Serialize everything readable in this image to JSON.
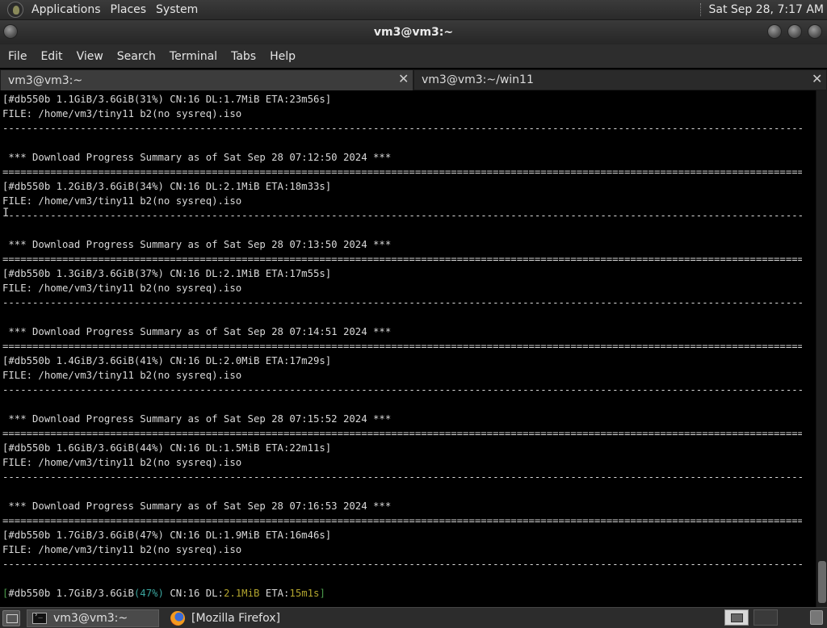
{
  "top_panel": {
    "menus": [
      "Applications",
      "Places",
      "System"
    ],
    "clock": "Sat Sep 28,  7:17 AM"
  },
  "window": {
    "title": "vm3@vm3:~"
  },
  "menubar": [
    "File",
    "Edit",
    "View",
    "Search",
    "Terminal",
    "Tabs",
    "Help"
  ],
  "tabs": [
    {
      "label": "vm3@vm3:~",
      "active": true
    },
    {
      "label": "vm3@vm3:~/win11",
      "active": false
    }
  ],
  "terminal": {
    "separator_dash": "-----------------------------------------------------------------------------------------------------------------------------------------------------",
    "separator_eq": "=====================================================================================================================================================",
    "first_status": "[#db550b 1.1GiB/3.6GiB(31%) CN:16 DL:1.7MiB ETA:23m56s]",
    "file_line": "FILE: /home/vm3/tiny11 b2(no sysreq).iso",
    "blocks": [
      {
        "summary": " *** Download Progress Summary as of Sat Sep 28 07:12:50 2024 ***",
        "status": "[#db550b 1.2GiB/3.6GiB(34%) CN:16 DL:2.1MiB ETA:18m33s]"
      },
      {
        "summary": " *** Download Progress Summary as of Sat Sep 28 07:13:50 2024 ***",
        "status": "[#db550b 1.3GiB/3.6GiB(37%) CN:16 DL:2.1MiB ETA:17m55s]"
      },
      {
        "summary": " *** Download Progress Summary as of Sat Sep 28 07:14:51 2024 ***",
        "status": "[#db550b 1.4GiB/3.6GiB(41%) CN:16 DL:2.0MiB ETA:17m29s]"
      },
      {
        "summary": " *** Download Progress Summary as of Sat Sep 28 07:15:52 2024 ***",
        "status": "[#db550b 1.6GiB/3.6GiB(44%) CN:16 DL:1.5MiB ETA:22m11s]"
      },
      {
        "summary": " *** Download Progress Summary as of Sat Sep 28 07:16:53 2024 ***",
        "status": "[#db550b 1.7GiB/3.6GiB(47%) CN:16 DL:1.9MiB ETA:16m46s]"
      }
    ],
    "live_status": {
      "bracket_open": "[",
      "gid": "#db550b 1.7GiB/3.6GiB",
      "percent": "(47%)",
      "cn": " CN:16 DL:",
      "speed": "2.1MiB",
      "eta_label": " ETA:",
      "eta": "15m1s",
      "bracket_close": "]"
    }
  },
  "taskbar": {
    "items": [
      {
        "label": "vm3@vm3:~",
        "icon": "terminal-icon",
        "active": true
      },
      {
        "label": "[Mozilla Firefox]",
        "icon": "firefox-icon",
        "active": false
      }
    ]
  },
  "colors": {
    "percent": "#3aa39c",
    "speed": "#b3a52e",
    "eta": "#b3a52e",
    "bracket": "#4a9a4a"
  }
}
